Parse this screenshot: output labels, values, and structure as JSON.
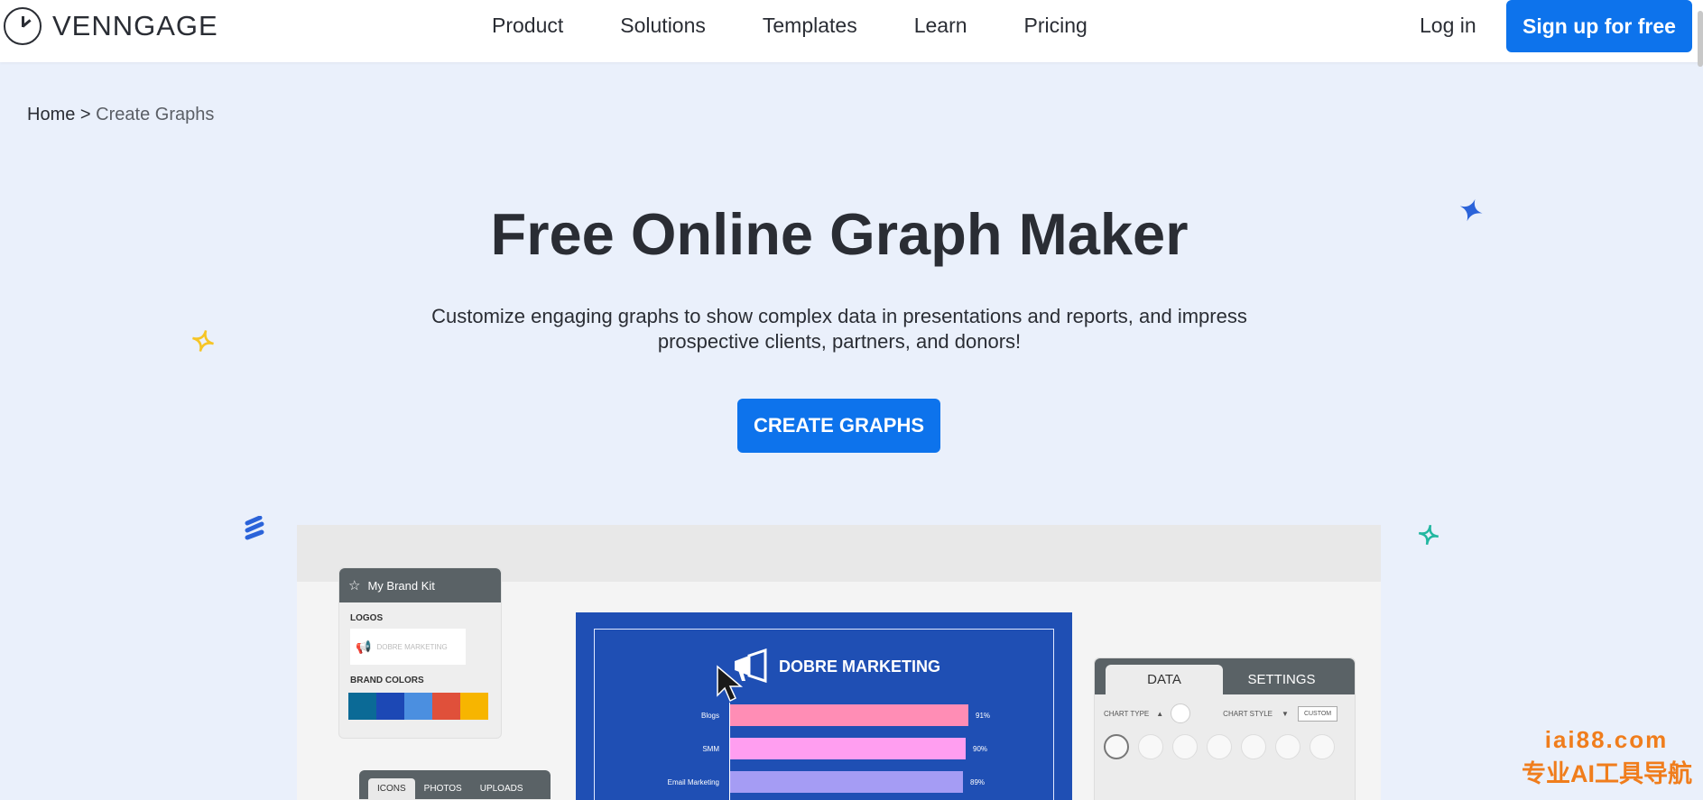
{
  "nav": {
    "brand": "VENNGAGE",
    "items": [
      "Product",
      "Solutions",
      "Templates",
      "Learn",
      "Pricing"
    ],
    "login": "Log in",
    "signup": "Sign up for free"
  },
  "breadcrumb": {
    "home": "Home",
    "separator": ">",
    "current": "Create Graphs"
  },
  "hero": {
    "title": "Free Online Graph Maker",
    "subtitle": "Customize engaging graphs to show complex data in presentations and reports, and impress prospective clients, partners, and donors!",
    "cta": "CREATE GRAPHS"
  },
  "preview": {
    "brand_kit": {
      "title": "My Brand Kit",
      "logos_label": "LOGOS",
      "logo_text": "DOBRE MARKETING",
      "colors_label": "BRAND COLORS",
      "colors": [
        "#0b6a96",
        "#1c48b5",
        "#4b8fe0",
        "#e0503a",
        "#f7b500"
      ]
    },
    "asset_tabs": [
      "ICONS",
      "PHOTOS",
      "UPLOADS"
    ],
    "poster": {
      "title": "DOBRE MARKETING",
      "bars": [
        {
          "label": "Blogs",
          "pct": "91%",
          "value": 91,
          "color": "#ff8db5"
        },
        {
          "label": "SMM",
          "pct": "90%",
          "value": 90,
          "color": "#ff9ef0"
        },
        {
          "label": "Email Marketing",
          "pct": "89%",
          "value": 89,
          "color": "#a59cf4"
        }
      ]
    },
    "data_panel": {
      "tabs": [
        "DATA",
        "SETTINGS"
      ],
      "chart_type_label": "CHART TYPE",
      "chart_style_label": "CHART STYLE",
      "custom_label": "CUSTOM"
    }
  },
  "watermark": {
    "line1": "iai88.com",
    "line2": "专业AI工具导航"
  },
  "colors": {
    "accent": "#0d73ec",
    "background": "#eaf0fb",
    "text": "#2a2d34"
  }
}
